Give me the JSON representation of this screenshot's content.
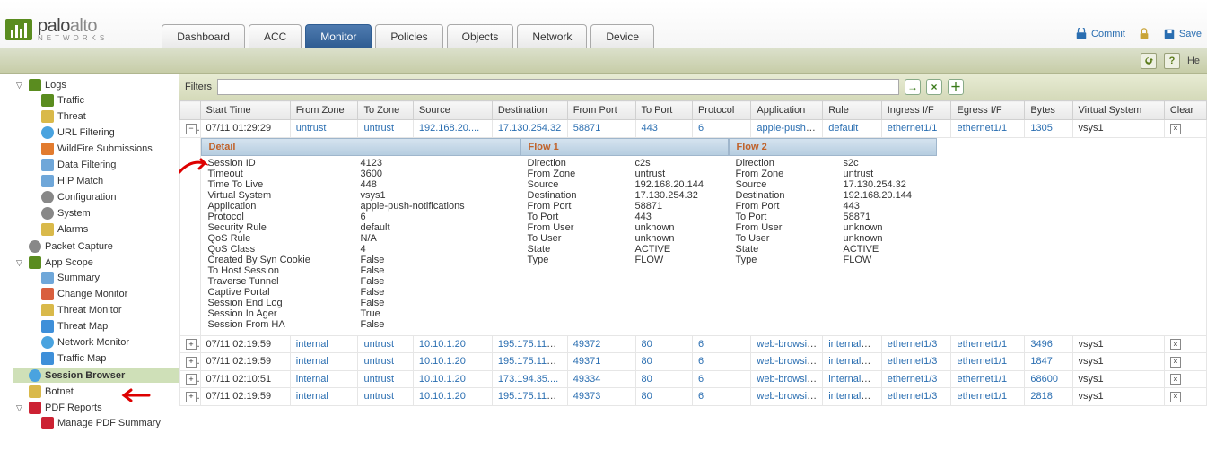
{
  "logo": {
    "brand1": "palo",
    "brand2": "alto",
    "sub": "NETWORKS"
  },
  "tabs": [
    "Dashboard",
    "ACC",
    "Monitor",
    "Policies",
    "Objects",
    "Network",
    "Device"
  ],
  "active_tab": "Monitor",
  "top_actions": {
    "commit": "Commit",
    "lock": "",
    "save": "Save"
  },
  "toolstrip_help": "He",
  "sidebar": {
    "logs": {
      "label": "Logs",
      "items": [
        "Traffic",
        "Threat",
        "URL Filtering",
        "WildFire Submissions",
        "Data Filtering",
        "HIP Match",
        "Configuration",
        "System",
        "Alarms"
      ]
    },
    "packet_capture": "Packet Capture",
    "app_scope": {
      "label": "App Scope",
      "items": [
        "Summary",
        "Change Monitor",
        "Threat Monitor",
        "Threat Map",
        "Network Monitor",
        "Traffic Map"
      ]
    },
    "session_browser": "Session Browser",
    "botnet": "Botnet",
    "pdf_reports": {
      "label": "PDF Reports",
      "items": [
        "Manage PDF Summary"
      ]
    }
  },
  "filters_label": "Filters",
  "filter_value": "",
  "columns": [
    "",
    "Start Time",
    "From Zone",
    "To Zone",
    "Source",
    "Destination",
    "From Port",
    "To Port",
    "Protocol",
    "Application",
    "Rule",
    "Ingress I/F",
    "Egress I/F",
    "Bytes",
    "Virtual System",
    "Clear"
  ],
  "rows": [
    {
      "start": "07/11 01:29:29",
      "fz": "untrust",
      "tz": "untrust",
      "src": "192.168.20....",
      "dst": "17.130.254.32",
      "fp": "58871",
      "tp": "443",
      "proto": "6",
      "app": "apple-push-notific...",
      "rule": "default",
      "ii": "ethernet1/1",
      "ei": "ethernet1/1",
      "bytes": "1305",
      "vsys": "vsys1",
      "expanded": true
    },
    {
      "start": "07/11 02:19:59",
      "fz": "internal",
      "tz": "untrust",
      "src": "10.10.1.20",
      "dst": "195.175.116....",
      "fp": "49372",
      "tp": "80",
      "proto": "6",
      "app": "web-browsing",
      "rule": "internal_i...",
      "ii": "ethernet1/3",
      "ei": "ethernet1/1",
      "bytes": "3496",
      "vsys": "vsys1"
    },
    {
      "start": "07/11 02:19:59",
      "fz": "internal",
      "tz": "untrust",
      "src": "10.10.1.20",
      "dst": "195.175.116....",
      "fp": "49371",
      "tp": "80",
      "proto": "6",
      "app": "web-browsing",
      "rule": "internal_i...",
      "ii": "ethernet1/3",
      "ei": "ethernet1/1",
      "bytes": "1847",
      "vsys": "vsys1"
    },
    {
      "start": "07/11 02:10:51",
      "fz": "internal",
      "tz": "untrust",
      "src": "10.10.1.20",
      "dst": "173.194.35....",
      "fp": "49334",
      "tp": "80",
      "proto": "6",
      "app": "web-browsing",
      "rule": "internal_i...",
      "ii": "ethernet1/3",
      "ei": "ethernet1/1",
      "bytes": "68600",
      "vsys": "vsys1"
    },
    {
      "start": "07/11 02:19:59",
      "fz": "internal",
      "tz": "untrust",
      "src": "10.10.1.20",
      "dst": "195.175.116....",
      "fp": "49373",
      "tp": "80",
      "proto": "6",
      "app": "web-browsing",
      "rule": "internal_i...",
      "ii": "ethernet1/3",
      "ei": "ethernet1/1",
      "bytes": "2818",
      "vsys": "vsys1"
    }
  ],
  "detail": {
    "col1": {
      "title": "Detail",
      "pairs": [
        [
          "Session ID",
          "4123"
        ],
        [
          "Timeout",
          "3600"
        ],
        [
          "Time To Live",
          "448"
        ],
        [
          "Virtual System",
          "vsys1"
        ],
        [
          "Application",
          "apple-push-notifications"
        ],
        [
          "Protocol",
          "6"
        ],
        [
          "Security Rule",
          "default"
        ],
        [
          "QoS Rule",
          "N/A"
        ],
        [
          "QoS Class",
          "4"
        ],
        [
          "Created By Syn Cookie",
          "False"
        ],
        [
          "To Host Session",
          "False"
        ],
        [
          "Traverse Tunnel",
          "False"
        ],
        [
          "Captive Portal",
          "False"
        ],
        [
          "Session End Log",
          "False"
        ],
        [
          "Session In Ager",
          "True"
        ],
        [
          "Session From HA",
          "False"
        ]
      ]
    },
    "col2": {
      "title": "Flow 1",
      "pairs": [
        [
          "Direction",
          "c2s"
        ],
        [
          "From Zone",
          "untrust"
        ],
        [
          "Source",
          "192.168.20.144"
        ],
        [
          "Destination",
          "17.130.254.32"
        ],
        [
          "From Port",
          "58871"
        ],
        [
          "To Port",
          "443"
        ],
        [
          "From User",
          "unknown"
        ],
        [
          "To User",
          "unknown"
        ],
        [
          "State",
          "ACTIVE"
        ],
        [
          "Type",
          "FLOW"
        ]
      ]
    },
    "col3": {
      "title": "Flow 2",
      "pairs": [
        [
          "Direction",
          "s2c"
        ],
        [
          "From Zone",
          "untrust"
        ],
        [
          "Source",
          "17.130.254.32"
        ],
        [
          "Destination",
          "192.168.20.144"
        ],
        [
          "From Port",
          "443"
        ],
        [
          "To Port",
          "58871"
        ],
        [
          "From User",
          "unknown"
        ],
        [
          "To User",
          "unknown"
        ],
        [
          "State",
          "ACTIVE"
        ],
        [
          "Type",
          "FLOW"
        ]
      ]
    }
  }
}
